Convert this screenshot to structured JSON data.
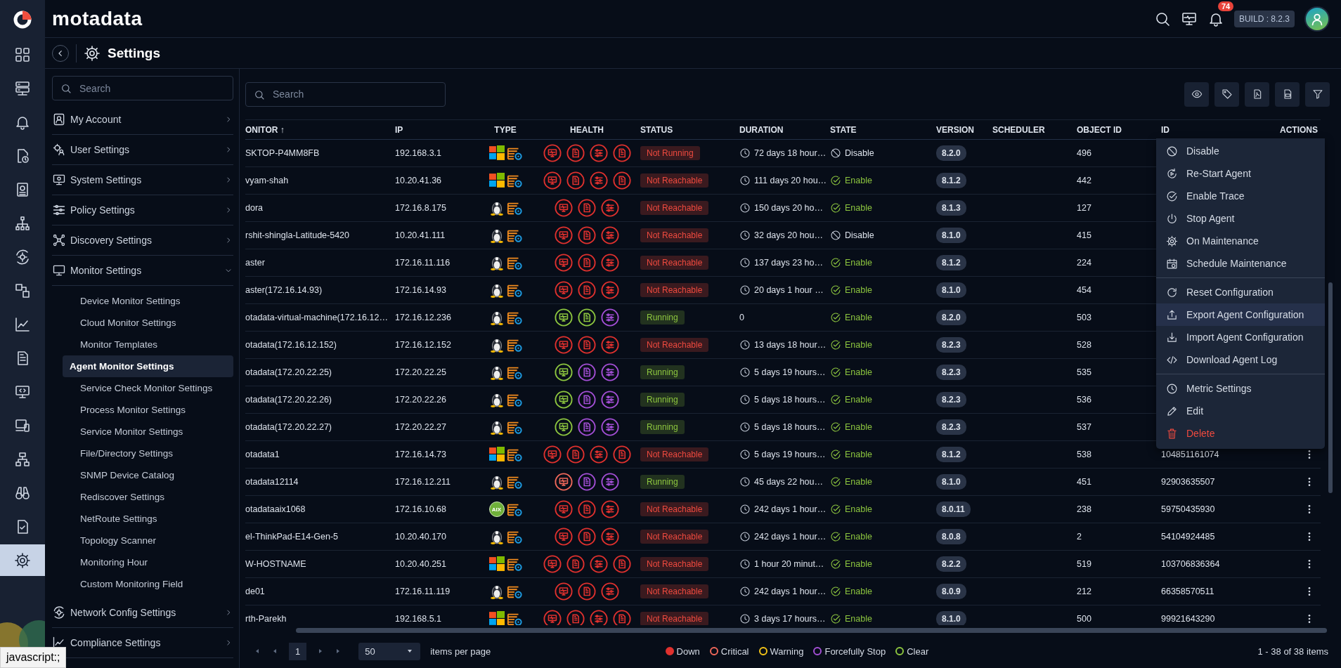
{
  "rail": [
    {
      "selected": false
    },
    {
      "selected": false
    },
    {
      "selected": false
    },
    {
      "selected": false
    },
    {
      "selected": false
    },
    {
      "selected": false
    },
    {
      "selected": false
    },
    {
      "selected": false
    },
    {
      "selected": false
    },
    {
      "selected": false
    },
    {
      "selected": false
    },
    {
      "selected": false
    },
    {
      "selected": false
    },
    {
      "selected": false
    },
    {
      "selected": false
    },
    {
      "selected": true
    }
  ],
  "topbar": {
    "logo": "motadata",
    "notifications": "74",
    "build": "BUILD : 8.2.3"
  },
  "header": {
    "title": "Settings"
  },
  "sidebar": {
    "search_placeholder": "Search",
    "sections": [
      {
        "label": "My Account",
        "expanded": false
      },
      {
        "label": "User Settings",
        "expanded": false
      },
      {
        "label": "System Settings",
        "expanded": false
      },
      {
        "label": "Policy Settings",
        "expanded": false
      },
      {
        "label": "Discovery Settings",
        "expanded": false
      },
      {
        "label": "Monitor Settings",
        "expanded": true,
        "children": [
          {
            "label": "Device Monitor Settings",
            "selected": false
          },
          {
            "label": "Cloud Monitor Settings",
            "selected": false
          },
          {
            "label": "Monitor Templates",
            "selected": false
          },
          {
            "label": "Agent Monitor Settings",
            "selected": true
          },
          {
            "label": "Service Check Monitor Settings",
            "selected": false
          },
          {
            "label": "Process Monitor Settings",
            "selected": false
          },
          {
            "label": "Service Monitor Settings",
            "selected": false
          },
          {
            "label": "File/Directory Settings",
            "selected": false
          },
          {
            "label": "SNMP Device Catalog",
            "selected": false
          },
          {
            "label": "Rediscover Settings",
            "selected": false
          },
          {
            "label": "NetRoute Settings",
            "selected": false
          },
          {
            "label": "Topology Scanner",
            "selected": false
          },
          {
            "label": "Monitoring Hour",
            "selected": false
          },
          {
            "label": "Custom Monitoring Field",
            "selected": false
          }
        ]
      },
      {
        "label": "Network Config Settings",
        "expanded": false
      },
      {
        "label": "Compliance Settings",
        "expanded": false
      }
    ]
  },
  "toolbar": {
    "search_placeholder": "Search"
  },
  "table": {
    "columns": [
      "ONITOR ↑",
      "IP",
      "TYPE",
      "HEALTH",
      "STATUS",
      "DURATION",
      "STATE",
      "VERSION",
      "SCHEDULER",
      "OBJECT ID",
      "ID",
      "ACTIONS"
    ],
    "rows": [
      {
        "monitor": "SKTOP-P4MM8FB",
        "ip": "192.168.3.1",
        "os": {
          "kind": "windows"
        },
        "health": [
          {
            "kind": "monitor",
            "color": "#e0312e"
          },
          {
            "kind": "file",
            "color": "#e0312e"
          },
          {
            "kind": "list",
            "color": "#e0312e"
          },
          {
            "kind": "doc",
            "color": "#e0312e"
          }
        ],
        "status": {
          "text": "Not Running",
          "ok": false
        },
        "duration": "72 days 18 hour…",
        "duration_clock": true,
        "state": {
          "text": "Disable",
          "enabled": false
        },
        "version": "8.2.0",
        "object_id": "496"
      },
      {
        "monitor": "vyam-shah",
        "ip": "10.20.41.36",
        "os": {
          "kind": "windows"
        },
        "health": [
          {
            "kind": "monitor",
            "color": "#e0312e"
          },
          {
            "kind": "file",
            "color": "#e0312e"
          },
          {
            "kind": "list",
            "color": "#e0312e"
          },
          {
            "kind": "doc",
            "color": "#e0312e"
          }
        ],
        "status": {
          "text": "Not Reachable",
          "ok": false
        },
        "duration": "111 days 20 hou…",
        "duration_clock": true,
        "state": {
          "text": "Enable",
          "enabled": true
        },
        "version": "8.1.2",
        "object_id": "442"
      },
      {
        "monitor": "dora",
        "ip": "172.16.8.175",
        "os": {
          "kind": "linux"
        },
        "health": [
          {
            "kind": "monitor",
            "color": "#e0312e"
          },
          {
            "kind": "file",
            "color": "#e0312e"
          },
          {
            "kind": "list",
            "color": "#e0312e"
          }
        ],
        "status": {
          "text": "Not Reachable",
          "ok": false
        },
        "duration": "150 days 20 ho…",
        "duration_clock": true,
        "state": {
          "text": "Enable",
          "enabled": true
        },
        "version": "8.1.3",
        "object_id": "127"
      },
      {
        "monitor": "rshit-shingla-Latitude-5420",
        "ip": "10.20.41.111",
        "os": {
          "kind": "linux"
        },
        "health": [
          {
            "kind": "monitor",
            "color": "#e0312e"
          },
          {
            "kind": "file",
            "color": "#e0312e"
          },
          {
            "kind": "list",
            "color": "#e0312e"
          }
        ],
        "status": {
          "text": "Not Reachable",
          "ok": false
        },
        "duration": "32 days 20 hou…",
        "duration_clock": true,
        "state": {
          "text": "Disable",
          "enabled": false
        },
        "version": "8.1.0",
        "object_id": "415"
      },
      {
        "monitor": "aster",
        "ip": "172.16.11.116",
        "os": {
          "kind": "linux"
        },
        "health": [
          {
            "kind": "monitor",
            "color": "#e0312e"
          },
          {
            "kind": "file",
            "color": "#e0312e"
          },
          {
            "kind": "list",
            "color": "#e0312e"
          }
        ],
        "status": {
          "text": "Not Reachable",
          "ok": false
        },
        "duration": "137 days 23 ho…",
        "duration_clock": true,
        "state": {
          "text": "Enable",
          "enabled": true
        },
        "version": "8.1.2",
        "object_id": "224"
      },
      {
        "monitor": "aster(172.16.14.93)",
        "ip": "172.16.14.93",
        "os": {
          "kind": "linux"
        },
        "health": [
          {
            "kind": "monitor",
            "color": "#e0312e"
          },
          {
            "kind": "file",
            "color": "#e0312e"
          },
          {
            "kind": "list",
            "color": "#e0312e"
          }
        ],
        "status": {
          "text": "Not Reachable",
          "ok": false
        },
        "duration": "20 days 1 hour …",
        "duration_clock": true,
        "state": {
          "text": "Enable",
          "enabled": true
        },
        "version": "8.1.0",
        "object_id": "454"
      },
      {
        "monitor": "otadata-virtual-machine(172.16.12…",
        "ip": "172.16.12.236",
        "os": {
          "kind": "linux"
        },
        "health": [
          {
            "kind": "monitor",
            "color": "#8dc63f"
          },
          {
            "kind": "file",
            "color": "#8dc63f"
          },
          {
            "kind": "list",
            "color": "#a44fd6"
          }
        ],
        "status": {
          "text": "Running",
          "ok": true
        },
        "duration": "0",
        "duration_clock": false,
        "state": {
          "text": "Enable",
          "enabled": true
        },
        "version": "8.2.0",
        "object_id": "503"
      },
      {
        "monitor": "otadata(172.16.12.152)",
        "ip": "172.16.12.152",
        "os": {
          "kind": "linux"
        },
        "health": [
          {
            "kind": "monitor",
            "color": "#e0312e"
          },
          {
            "kind": "file",
            "color": "#e0312e"
          },
          {
            "kind": "list",
            "color": "#e0312e"
          }
        ],
        "status": {
          "text": "Not Reachable",
          "ok": false
        },
        "duration": "13 days 18 hour…",
        "duration_clock": true,
        "state": {
          "text": "Enable",
          "enabled": true
        },
        "version": "8.2.3",
        "object_id": "528"
      },
      {
        "monitor": "otadata(172.20.22.25)",
        "ip": "172.20.22.25",
        "os": {
          "kind": "linux"
        },
        "health": [
          {
            "kind": "monitor",
            "color": "#8dc63f"
          },
          {
            "kind": "file",
            "color": "#a44fd6"
          },
          {
            "kind": "list",
            "color": "#a44fd6"
          }
        ],
        "status": {
          "text": "Running",
          "ok": true
        },
        "duration": "5 days 19 hours…",
        "duration_clock": true,
        "state": {
          "text": "Enable",
          "enabled": true
        },
        "version": "8.2.3",
        "object_id": "535"
      },
      {
        "monitor": "otadata(172.20.22.26)",
        "ip": "172.20.22.26",
        "os": {
          "kind": "linux"
        },
        "health": [
          {
            "kind": "monitor",
            "color": "#8dc63f"
          },
          {
            "kind": "file",
            "color": "#a44fd6"
          },
          {
            "kind": "list",
            "color": "#a44fd6"
          }
        ],
        "status": {
          "text": "Running",
          "ok": true
        },
        "duration": "5 days 18 hours…",
        "duration_clock": true,
        "state": {
          "text": "Enable",
          "enabled": true
        },
        "version": "8.2.3",
        "object_id": "536"
      },
      {
        "monitor": "otadata(172.20.22.27)",
        "ip": "172.20.22.27",
        "os": {
          "kind": "linux"
        },
        "health": [
          {
            "kind": "monitor",
            "color": "#8dc63f"
          },
          {
            "kind": "file",
            "color": "#a44fd6"
          },
          {
            "kind": "list",
            "color": "#a44fd6"
          }
        ],
        "status": {
          "text": "Running",
          "ok": true
        },
        "duration": "5 days 18 hours…",
        "duration_clock": true,
        "state": {
          "text": "Enable",
          "enabled": true
        },
        "version": "8.2.3",
        "object_id": "537"
      },
      {
        "monitor": "otadata1",
        "ip": "172.16.14.73",
        "os": {
          "kind": "windows"
        },
        "health": [
          {
            "kind": "monitor",
            "color": "#e0312e"
          },
          {
            "kind": "file",
            "color": "#e0312e"
          },
          {
            "kind": "list",
            "color": "#e0312e"
          },
          {
            "kind": "doc",
            "color": "#e0312e"
          }
        ],
        "status": {
          "text": "Not Reachable",
          "ok": false
        },
        "duration": "5 days 19 hours…",
        "duration_clock": true,
        "state": {
          "text": "Enable",
          "enabled": true
        },
        "version": "8.1.2",
        "object_id": "538",
        "id": "104851161074"
      },
      {
        "monitor": "otadata12114",
        "ip": "172.16.12.211",
        "os": {
          "kind": "linux"
        },
        "health": [
          {
            "kind": "monitor",
            "color": "#f0685a"
          },
          {
            "kind": "file",
            "color": "#a44fd6"
          },
          {
            "kind": "list",
            "color": "#a44fd6"
          }
        ],
        "status": {
          "text": "Running",
          "ok": true
        },
        "duration": "45 days 22 hou…",
        "duration_clock": true,
        "state": {
          "text": "Enable",
          "enabled": true
        },
        "version": "8.1.0",
        "object_id": "451",
        "id": "92903635507"
      },
      {
        "monitor": "otadataaix1068",
        "ip": "172.16.10.68",
        "os": {
          "kind": "aix",
          "text": "AIX"
        },
        "health": [
          {
            "kind": "monitor",
            "color": "#e0312e"
          },
          {
            "kind": "file",
            "color": "#e0312e"
          },
          {
            "kind": "list",
            "color": "#e0312e"
          }
        ],
        "status": {
          "text": "Not Reachable",
          "ok": false
        },
        "duration": "242 days 1 hour…",
        "duration_clock": true,
        "state": {
          "text": "Enable",
          "enabled": true
        },
        "version": "8.0.11",
        "object_id": "238",
        "id": "59750435930"
      },
      {
        "monitor": "el-ThinkPad-E14-Gen-5",
        "ip": "10.20.40.170",
        "os": {
          "kind": "linux"
        },
        "health": [
          {
            "kind": "monitor",
            "color": "#e0312e"
          },
          {
            "kind": "file",
            "color": "#e0312e"
          },
          {
            "kind": "list",
            "color": "#e0312e"
          }
        ],
        "status": {
          "text": "Not Reachable",
          "ok": false
        },
        "duration": "242 days 1 hour…",
        "duration_clock": true,
        "state": {
          "text": "Enable",
          "enabled": true
        },
        "version": "8.0.8",
        "object_id": "2",
        "id": "54104924485"
      },
      {
        "monitor": "W-HOSTNAME",
        "ip": "10.20.40.251",
        "os": {
          "kind": "windows"
        },
        "health": [
          {
            "kind": "monitor",
            "color": "#e0312e"
          },
          {
            "kind": "file",
            "color": "#e0312e"
          },
          {
            "kind": "list",
            "color": "#e0312e"
          },
          {
            "kind": "doc",
            "color": "#e0312e"
          }
        ],
        "status": {
          "text": "Not Reachable",
          "ok": false
        },
        "duration": "1 hour 20 minut…",
        "duration_clock": true,
        "state": {
          "text": "Enable",
          "enabled": true
        },
        "version": "8.2.2",
        "object_id": "519",
        "id": "103706836364"
      },
      {
        "monitor": "de01",
        "ip": "172.16.11.119",
        "os": {
          "kind": "linux"
        },
        "health": [
          {
            "kind": "monitor",
            "color": "#e0312e"
          },
          {
            "kind": "file",
            "color": "#e0312e"
          },
          {
            "kind": "list",
            "color": "#e0312e"
          }
        ],
        "status": {
          "text": "Not Reachable",
          "ok": false
        },
        "duration": "242 days 1 hour…",
        "duration_clock": true,
        "state": {
          "text": "Enable",
          "enabled": true
        },
        "version": "8.0.9",
        "object_id": "212",
        "id": "66358570511"
      },
      {
        "monitor": "rth-Parekh",
        "ip": "192.168.5.1",
        "os": {
          "kind": "windows"
        },
        "health": [
          {
            "kind": "monitor",
            "color": "#e0312e"
          },
          {
            "kind": "file",
            "color": "#e0312e"
          },
          {
            "kind": "list",
            "color": "#e0312e"
          },
          {
            "kind": "doc",
            "color": "#e0312e"
          }
        ],
        "status": {
          "text": "Not Reachable",
          "ok": false
        },
        "duration": "3 days 17 hours…",
        "duration_clock": true,
        "state": {
          "text": "Enable",
          "enabled": true
        },
        "version": "8.1.0",
        "object_id": "500",
        "id": "99921643290"
      }
    ]
  },
  "action_menu": {
    "groups": [
      [
        {
          "label": "Disable",
          "highlighted": false,
          "danger": false
        },
        {
          "label": "Re-Start Agent",
          "highlighted": false,
          "danger": false
        },
        {
          "label": "Enable Trace",
          "highlighted": false,
          "danger": false
        },
        {
          "label": "Stop Agent",
          "highlighted": false,
          "danger": false
        },
        {
          "label": "On Maintenance",
          "highlighted": false,
          "danger": false
        },
        {
          "label": "Schedule Maintenance",
          "highlighted": false,
          "danger": false
        }
      ],
      [
        {
          "label": "Reset Configuration",
          "highlighted": false,
          "danger": false
        },
        {
          "label": "Export Agent Configuration",
          "highlighted": true,
          "danger": false
        },
        {
          "label": "Import Agent Configuration",
          "highlighted": false,
          "danger": false
        },
        {
          "label": "Download Agent Log",
          "highlighted": false,
          "danger": false
        }
      ],
      [
        {
          "label": "Metric Settings",
          "highlighted": false,
          "danger": false
        },
        {
          "label": "Edit",
          "highlighted": false,
          "danger": false
        },
        {
          "label": "Delete",
          "highlighted": false,
          "danger": true
        }
      ]
    ]
  },
  "footer": {
    "page": "1",
    "per_page": "50",
    "per_page_label": "items per page",
    "legend": [
      {
        "label": "Down",
        "color": "#e0312e",
        "filled": true
      },
      {
        "label": "Critical",
        "color": "#f0685a",
        "filled": false
      },
      {
        "label": "Warning",
        "color": "#f5c518",
        "filled": false
      },
      {
        "label": "Forcefully Stop",
        "color": "#a44fd6",
        "filled": false
      },
      {
        "label": "Clear",
        "color": "#8dc63f",
        "filled": false
      }
    ],
    "summary": "1 - 38 of 38 items"
  },
  "browser_status": "javascript:;"
}
